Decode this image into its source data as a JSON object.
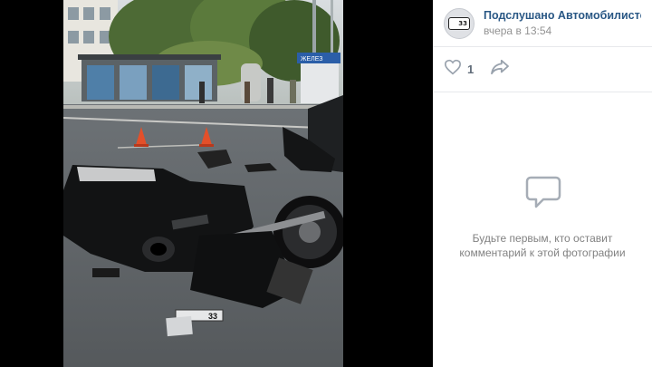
{
  "post": {
    "author": "Подслушано Автомобилистов | Вл",
    "time": "вчера в 13:54",
    "avatar_text": "33"
  },
  "actions": {
    "like_count": "1",
    "like_icon": "heart-icon",
    "share_icon": "share-arrow-icon"
  },
  "comments": {
    "empty_line1": "Будьте первым, кто оставит",
    "empty_line2": "комментарий к этой фотографии",
    "icon": "comment-bubble-icon"
  },
  "photo": {
    "sign_text": "ЖЕЛЕЗ",
    "plate_text": "33"
  },
  "colors": {
    "link": "#2a5885",
    "muted": "#939393",
    "icon": "#99a2ad"
  }
}
